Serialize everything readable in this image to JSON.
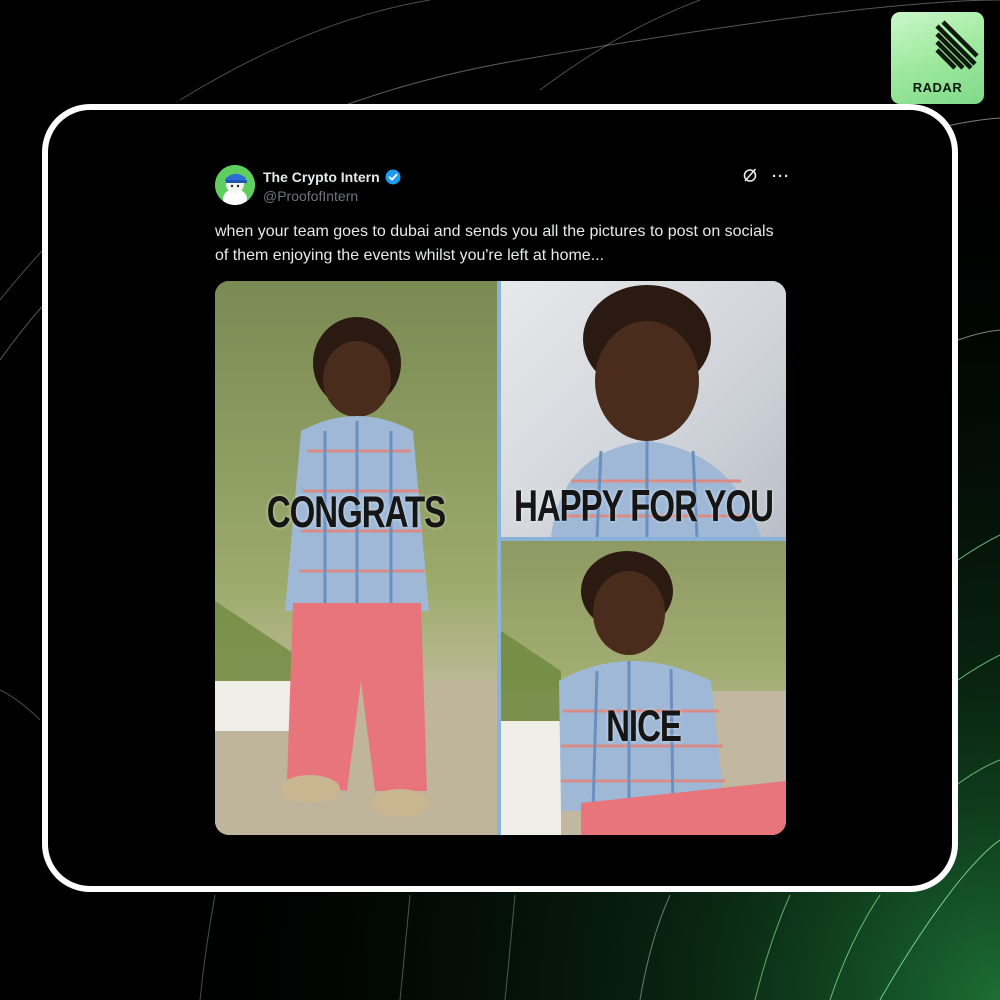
{
  "brand": {
    "logo_text": "RADAR",
    "logo_color": "#9be89b"
  },
  "tweet": {
    "display_name": "The Crypto Intern",
    "handle": "@ProofofIntern",
    "verified": true,
    "text": "when your team goes to dubai and sends you all the pictures to post on socials of them enjoying the events whilst you're left at home...",
    "grok_icon": "grok-icon",
    "more_icon": "more-options-icon",
    "more_glyph": "···"
  },
  "meme": {
    "captions": {
      "left": "CONGRATS",
      "top_right": "HAPPY FOR YOU",
      "bottom_right": "NICE"
    }
  },
  "colors": {
    "background": "#000000",
    "frame": "#ffffff",
    "accent_green": "#2fbf5a",
    "verified_blue": "#1d9bf0"
  }
}
